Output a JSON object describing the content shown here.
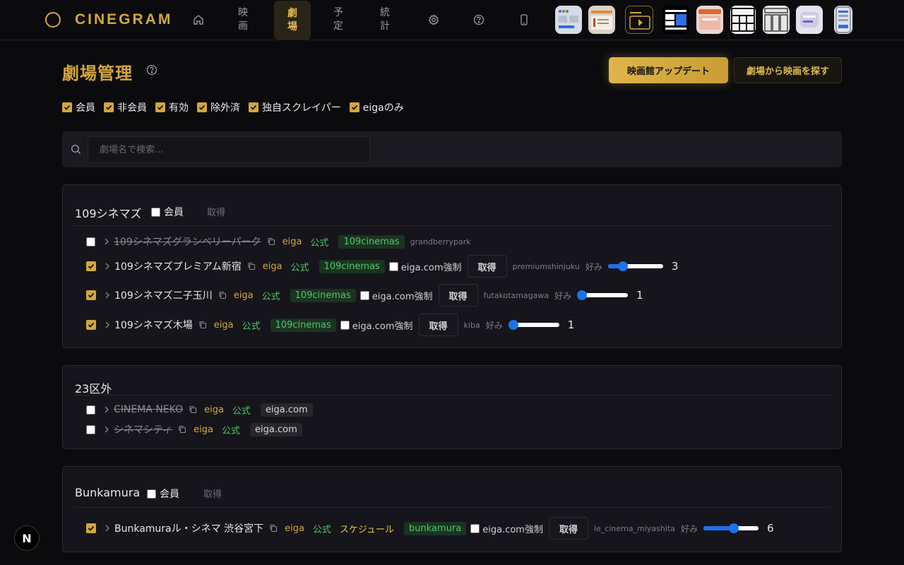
{
  "app": {
    "name": "CINEGRAM"
  },
  "nav": {
    "items": [
      {
        "label": "映画"
      },
      {
        "label": "劇場",
        "active": true
      },
      {
        "label": "予定"
      },
      {
        "label": "統計"
      }
    ],
    "icons": [
      "home-icon",
      "gear-icon",
      "help-circle-icon",
      "mobile-icon"
    ],
    "layout_thumbnails": [
      "layout-preset-1",
      "layout-preset-2",
      "layout-preset-3",
      "layout-preset-4",
      "layout-preset-5",
      "layout-preset-6",
      "layout-preset-7",
      "layout-preset-8",
      "layout-preset-9"
    ]
  },
  "page": {
    "title": "劇場管理",
    "update_button": "映画館アップデート",
    "find_button": "劇場から映画を探す"
  },
  "filters": [
    {
      "label": "会員",
      "checked": true
    },
    {
      "label": "非会員",
      "checked": true
    },
    {
      "label": "有効",
      "checked": true
    },
    {
      "label": "除外済",
      "checked": true
    },
    {
      "label": "独自スクレイパー",
      "checked": true
    },
    {
      "label": "eigaのみ",
      "checked": true
    }
  ],
  "search": {
    "placeholder": "劇場名で検索...",
    "value": ""
  },
  "labels": {
    "member": "会員",
    "fetch": "取得",
    "eiga": "eiga",
    "official": "公式",
    "force": "eiga.com強制",
    "preference": "好み"
  },
  "groups": [
    {
      "name": "109シネマズ",
      "member_checked": false,
      "theaters": [
        {
          "name": "109シネマズグランベリーパーク",
          "checked": false,
          "disabled": true,
          "tag": "109cinemas",
          "slug": "grandberrypark"
        },
        {
          "name": "109シネマズプレミアム新宿",
          "checked": true,
          "tag": "109cinemas",
          "force": false,
          "slug": "premiumshinjuku",
          "preference": 3
        },
        {
          "name": "109シネマズ二子玉川",
          "checked": true,
          "tag": "109cinemas",
          "force": false,
          "slug": "futakotamagawa",
          "preference": 1
        },
        {
          "name": "109シネマズ木場",
          "checked": true,
          "tag": "109cinemas",
          "force": false,
          "slug": "kiba",
          "preference": 1
        }
      ]
    },
    {
      "name": "23区外",
      "theaters": [
        {
          "name": "CINEMA NEKO",
          "checked": false,
          "disabled": true,
          "tag": "eiga.com"
        },
        {
          "name": "シネマシティ",
          "checked": false,
          "disabled": true,
          "tag": "eiga.com"
        }
      ]
    },
    {
      "name": "Bunkamura",
      "member_checked": false,
      "theaters": [
        {
          "name": "Bunkamuraル・シネマ 渋谷宮下",
          "checked": true,
          "schedule": "スケジュール",
          "tag": "bunkamura",
          "force": false,
          "slug": "le_cinema_miyashita",
          "preference": 6
        }
      ]
    }
  ],
  "dev_badge": {
    "letter": "N"
  },
  "colors": {
    "accent": "#d4a73a",
    "official": "#4cc96a",
    "slider": "#1a73e8",
    "background": "#0b0b0e"
  }
}
